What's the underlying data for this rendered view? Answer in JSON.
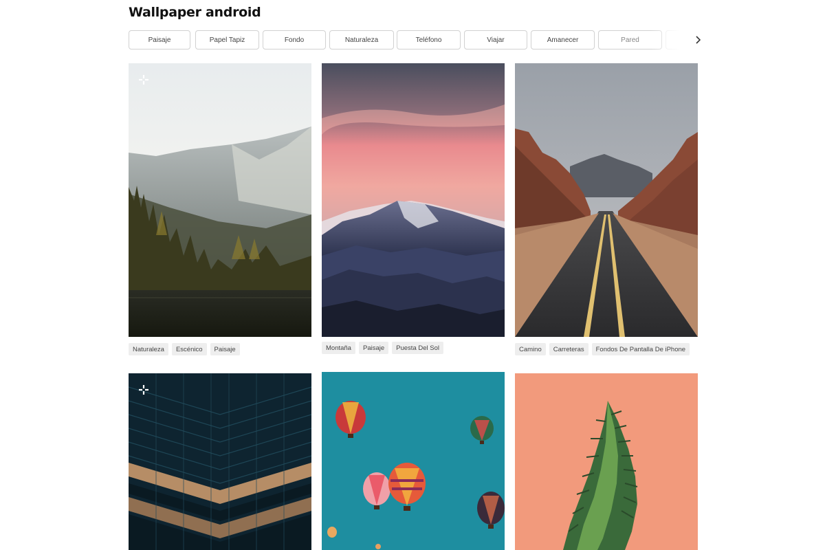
{
  "page": {
    "title": "Wallpaper android"
  },
  "filters": {
    "chips": [
      "Paisaje",
      "Papel Tapiz",
      "Fondo",
      "Naturaleza",
      "Teléfono",
      "Viajar",
      "Amanecer",
      "Pared"
    ],
    "next_icon": "chevron-right-icon"
  },
  "cards": [
    {
      "image": "misty-mountain-forest-lake",
      "plus_icon": true,
      "tags": [
        "Naturaleza",
        "Escénico",
        "Paisaje"
      ]
    },
    {
      "image": "pink-sunset-mountain-range",
      "plus_icon": false,
      "tags": [
        "Montaña",
        "Paisaje",
        "Puesta Del Sol"
      ]
    },
    {
      "image": "desert-road-red-rocks",
      "plus_icon": false,
      "tags": [
        "Camino",
        "Carreteras",
        "Fondos De Pantalla De iPhone"
      ]
    },
    {
      "image": "dark-glass-building-facade",
      "plus_icon": true,
      "tags": []
    },
    {
      "image": "hot-air-balloons-teal-sky",
      "plus_icon": false,
      "tags": []
    },
    {
      "image": "green-plant-pink-background",
      "plus_icon": false,
      "tags": []
    }
  ],
  "colors": {
    "chip_border": "#d1d1d1",
    "tag_bg": "#eeeeee",
    "title": "#111111"
  }
}
